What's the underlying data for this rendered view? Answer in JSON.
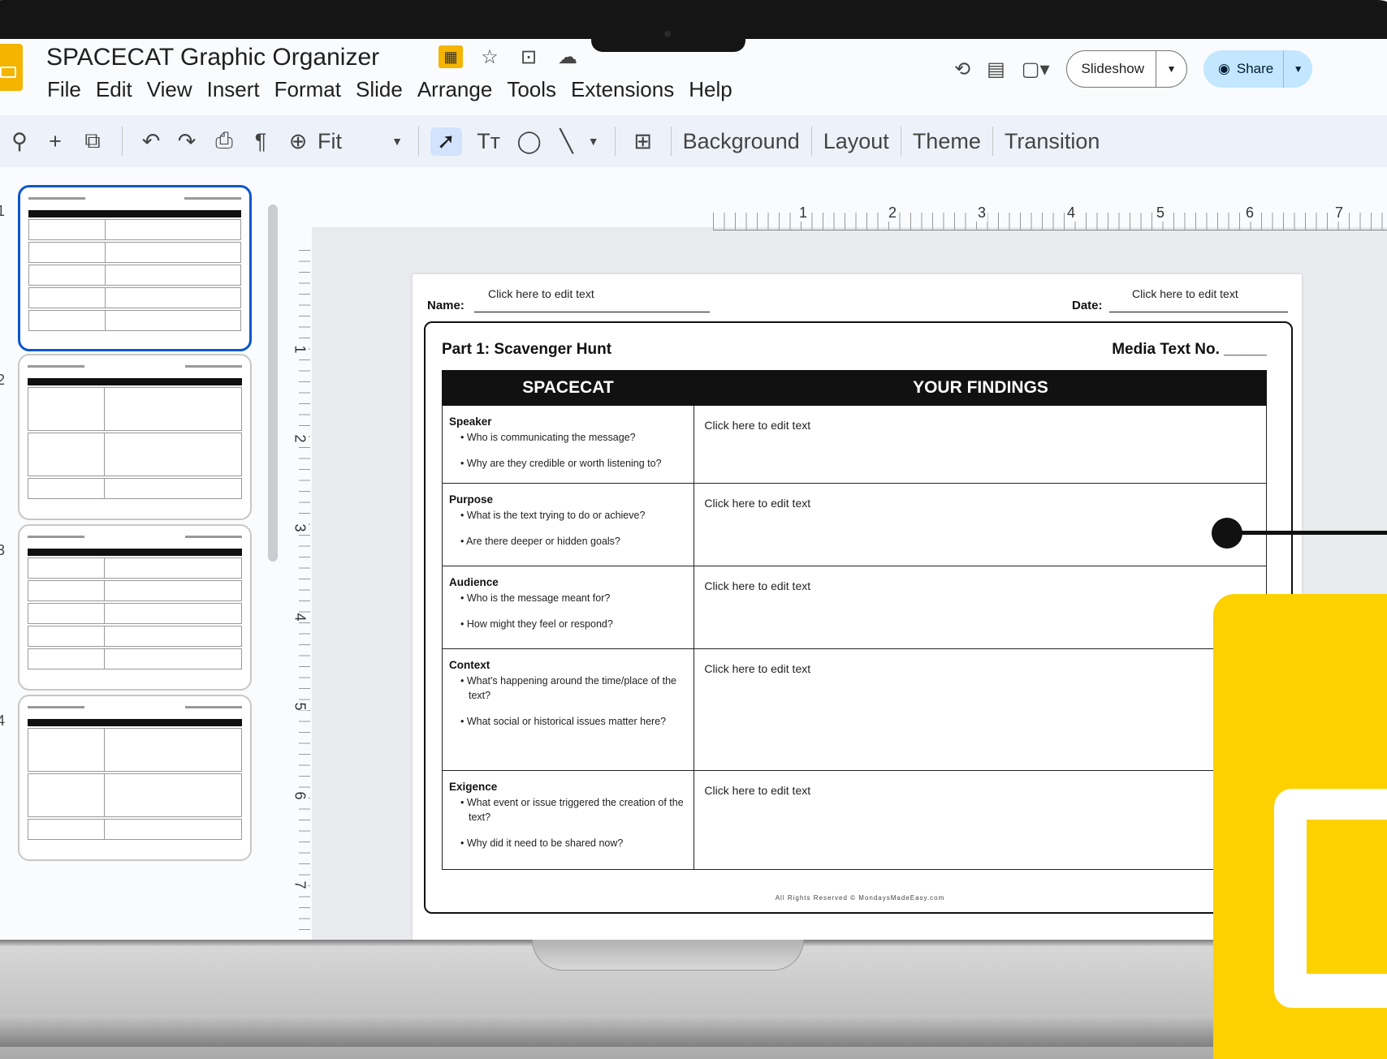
{
  "app": {
    "title": "SPACECAT Graphic Organizer",
    "title_icons": [
      "slides-move-icon",
      "star-icon",
      "folder-icon",
      "cloud-status-icon"
    ],
    "menu": [
      "File",
      "Edit",
      "View",
      "Insert",
      "Format",
      "Slide",
      "Arrange",
      "Tools",
      "Extensions",
      "Help"
    ],
    "slideshow_label": "Slideshow",
    "share_label": "Share",
    "accent": "#0b57d0",
    "brand_yellow": "#fdd100"
  },
  "toolbar": {
    "zoom_label": "Fit",
    "background_label": "Background",
    "layout_label": "Layout",
    "theme_label": "Theme",
    "transition_label": "Transition"
  },
  "filmstrip": {
    "slide_numbers": [
      "1",
      "2",
      "3",
      "4"
    ]
  },
  "rulers": {
    "horizontal": [
      "1",
      "2",
      "3",
      "4",
      "5",
      "6",
      "7"
    ],
    "vertical": [
      "1",
      "2",
      "3",
      "4",
      "5",
      "6",
      "7"
    ]
  },
  "slide": {
    "name_label": "Name:",
    "name_value": "Click here to edit text",
    "date_label": "Date:",
    "date_value": "Click here to edit text",
    "part_title": "Part 1: Scavenger Hunt",
    "media_text_label": "Media Text No. _____",
    "col1_header": "SPACECAT",
    "col2_header": "YOUR FINDINGS",
    "rows": [
      {
        "heading": "Speaker",
        "bullets": [
          "Who is communicating the message?",
          "Why are they credible or worth listening to?"
        ],
        "finding": "Click here to edit text"
      },
      {
        "heading": "Purpose",
        "bullets": [
          "What is the text trying to do or achieve?",
          "Are there deeper or hidden goals?"
        ],
        "finding": "Click here to edit text"
      },
      {
        "heading": "Audience",
        "bullets": [
          "Who is the message meant for?",
          "How might they feel or respond?"
        ],
        "finding": "Click here to edit text"
      },
      {
        "heading": "Context",
        "bullets": [
          "What's happening around the time/place of the text?",
          "What social or historical issues matter here?"
        ],
        "finding": "Click here to edit text"
      },
      {
        "heading": "Exigence",
        "bullets": [
          "What event or issue triggered the creation of the text?",
          "Why did it need to be shared now?"
        ],
        "finding": "Click here to edit text"
      }
    ],
    "footer": "All Rights Reserved © MondaysMadeEasy.com"
  }
}
